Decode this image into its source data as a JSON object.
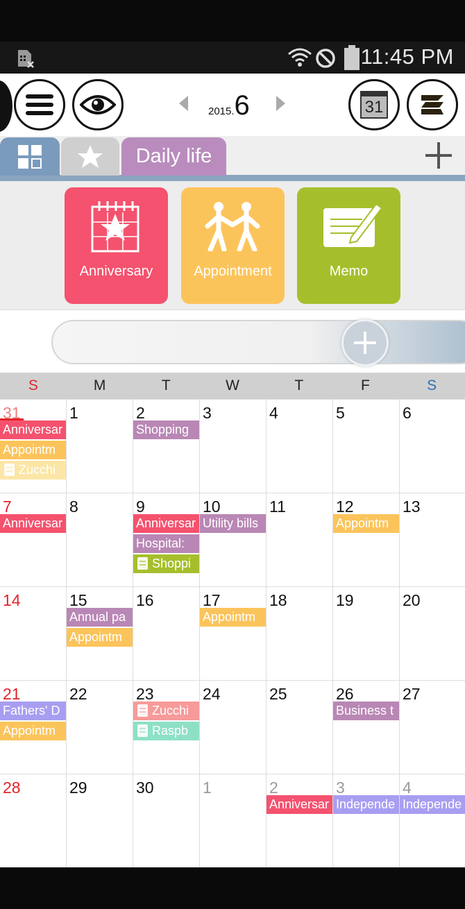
{
  "status_bar": {
    "time": "11:45 PM"
  },
  "toolbar": {
    "year": "2015.",
    "month": "6",
    "calendar_icon_day": "31"
  },
  "tabs": {
    "daily_label": "Daily life"
  },
  "categories": [
    {
      "label": "Anniversary",
      "color": "#f4526e"
    },
    {
      "label": "Appointment",
      "color": "#fbc45b"
    },
    {
      "label": "Memo",
      "color": "#a5bf2c"
    }
  ],
  "weekday_headers": [
    "S",
    "M",
    "T",
    "W",
    "T",
    "F",
    "S"
  ],
  "weekday_colors": {
    "sun": "#e3242b",
    "sat": "#2f6fb3",
    "other": "#222222"
  },
  "event_colors": {
    "anniversary": "#f4526e",
    "appointment": "#fbc45b",
    "purple": "#b987b5",
    "memo_lightyellow": "#fbe6a6",
    "memo_green": "#a5bf2c",
    "memo_pink": "#f79a9a",
    "memo_teal": "#8de0c6",
    "lavender": "#a79ef2"
  },
  "weeks": [
    [
      {
        "day": "31",
        "other": true,
        "today": true,
        "events": [
          {
            "label": "Anniversar",
            "type": "anniversary"
          },
          {
            "label": "Appointm",
            "type": "appointment"
          },
          {
            "label": "Zucchi",
            "type": "memo_lightyellow",
            "memo": true
          }
        ]
      },
      {
        "day": "1",
        "events": []
      },
      {
        "day": "2",
        "events": [
          {
            "label": "Shopping",
            "type": "purple"
          }
        ]
      },
      {
        "day": "3",
        "events": []
      },
      {
        "day": "4",
        "events": []
      },
      {
        "day": "5",
        "events": []
      },
      {
        "day": "6",
        "events": []
      }
    ],
    [
      {
        "day": "7",
        "events": [
          {
            "label": "Anniversar",
            "type": "anniversary"
          }
        ]
      },
      {
        "day": "8",
        "events": []
      },
      {
        "day": "9",
        "events": [
          {
            "label": "Anniversar",
            "type": "anniversary"
          },
          {
            "label": "Hospital:",
            "type": "purple"
          },
          {
            "label": "Shoppi",
            "type": "memo_green",
            "memo": true
          }
        ]
      },
      {
        "day": "10",
        "events": [
          {
            "label": "Utility bills",
            "type": "purple"
          }
        ]
      },
      {
        "day": "11",
        "events": []
      },
      {
        "day": "12",
        "events": [
          {
            "label": "Appointm",
            "type": "appointment"
          }
        ]
      },
      {
        "day": "13",
        "events": []
      }
    ],
    [
      {
        "day": "14",
        "events": []
      },
      {
        "day": "15",
        "events": [
          {
            "label": "Annual pa",
            "type": "purple"
          },
          {
            "label": "Appointm",
            "type": "appointment"
          }
        ]
      },
      {
        "day": "16",
        "events": []
      },
      {
        "day": "17",
        "events": [
          {
            "label": "Appointm",
            "type": "appointment"
          }
        ]
      },
      {
        "day": "18",
        "events": []
      },
      {
        "day": "19",
        "events": []
      },
      {
        "day": "20",
        "events": []
      }
    ],
    [
      {
        "day": "21",
        "events": [
          {
            "label": "Fathers' D",
            "type": "lavender"
          },
          {
            "label": "Appointm",
            "type": "appointment"
          }
        ]
      },
      {
        "day": "22",
        "events": []
      },
      {
        "day": "23",
        "events": [
          {
            "label": "Zucchi",
            "type": "memo_pink",
            "memo": true
          },
          {
            "label": "Raspb",
            "type": "memo_teal",
            "memo": true
          }
        ]
      },
      {
        "day": "24",
        "events": []
      },
      {
        "day": "25",
        "events": []
      },
      {
        "day": "26",
        "events": [
          {
            "label": "Business t",
            "type": "purple"
          }
        ]
      },
      {
        "day": "27",
        "events": []
      }
    ],
    [
      {
        "day": "28",
        "events": []
      },
      {
        "day": "29",
        "events": []
      },
      {
        "day": "30",
        "events": []
      },
      {
        "day": "1",
        "other": true,
        "events": []
      },
      {
        "day": "2",
        "other": true,
        "events": [
          {
            "label": "Anniversar",
            "type": "anniversary"
          }
        ]
      },
      {
        "day": "3",
        "other": true,
        "events": [
          {
            "label": "Independe",
            "type": "lavender"
          }
        ]
      },
      {
        "day": "4",
        "other": true,
        "events": [
          {
            "label": "Independe",
            "type": "lavender"
          }
        ]
      }
    ]
  ]
}
